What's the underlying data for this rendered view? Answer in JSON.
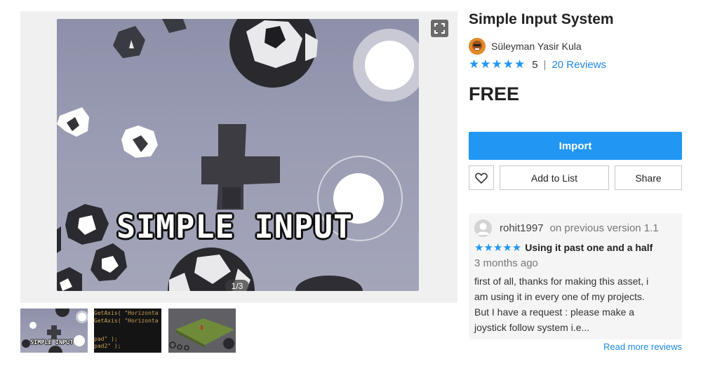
{
  "product": {
    "title": "Simple Input System",
    "publisher": "Süleyman Yasir Kula",
    "rating_value": "5",
    "reviews_link": "20 Reviews",
    "price": "FREE"
  },
  "gallery": {
    "hero_text": "SIMPLE INPUT",
    "counter": "1/3",
    "thumbnails": [
      {
        "label": "SIMPLE INPUT"
      },
      {
        "code_lines": [
          "GetAxis( \"Horizonta",
          "GetAxis( \"Horizonta",
          "",
          "pad\" );",
          "pad2\" );"
        ]
      },
      {}
    ]
  },
  "actions": {
    "import_label": "Import",
    "add_to_list_label": "Add to List",
    "share_label": "Share"
  },
  "review": {
    "user": "rohit1997",
    "version": "on previous version 1.1",
    "stars": "★★★★★",
    "headline": "Using it past one and a half",
    "date": "3 months ago",
    "body_lines": [
      "first of all, thanks for making this asset, i",
      "am using it in every one of my projects.",
      "But I have a request : please make a",
      "joystick follow system i.e..."
    ],
    "read_more": "Read more reviews"
  },
  "colors": {
    "accent": "#2196f3",
    "link": "#1e88e5"
  }
}
